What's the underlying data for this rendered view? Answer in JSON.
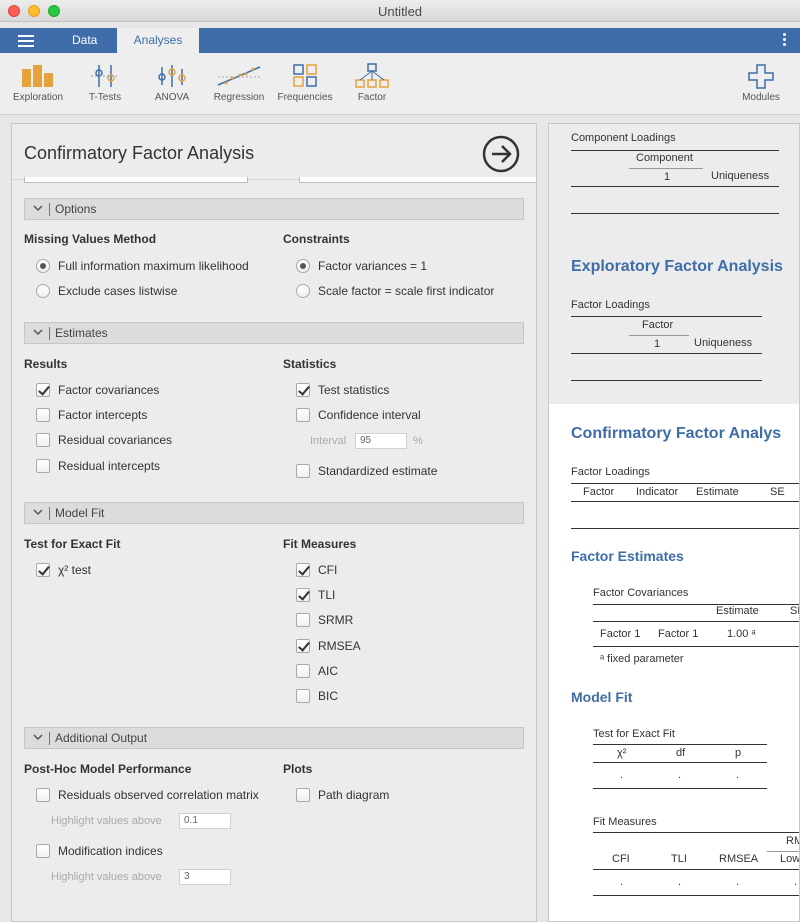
{
  "window": {
    "title": "Untitled"
  },
  "tabs": {
    "data": "Data",
    "analyses": "Analyses"
  },
  "ribbon": [
    {
      "label": "Exploration",
      "icon": "exploration-icon"
    },
    {
      "label": "T-Tests",
      "icon": "ttests-icon"
    },
    {
      "label": "ANOVA",
      "icon": "anova-icon"
    },
    {
      "label": "Regression",
      "icon": "regression-icon"
    },
    {
      "label": "Frequencies",
      "icon": "frequencies-icon"
    },
    {
      "label": "Factor",
      "icon": "factor-icon"
    },
    {
      "label": "Modules",
      "icon": "modules-icon"
    }
  ],
  "panel": {
    "title": "Confirmatory Factor Analysis"
  },
  "options": {
    "section": "Options",
    "missing": {
      "title": "Missing Values Method",
      "fiml": "Full information maximum likelihood",
      "listwise": "Exclude cases listwise"
    },
    "constraints": {
      "title": "Constraints",
      "var1": "Factor variances = 1",
      "scale": "Scale factor = scale first indicator"
    }
  },
  "estimates": {
    "section": "Estimates",
    "results": {
      "title": "Results",
      "fcov": "Factor covariances",
      "fint": "Factor intercepts",
      "rcov": "Residual covariances",
      "rint": "Residual intercepts"
    },
    "statistics": {
      "title": "Statistics",
      "test": "Test statistics",
      "ci": "Confidence interval",
      "interval_label": "Interval",
      "interval_value": "95",
      "interval_unit": "%",
      "std": "Standardized estimate"
    }
  },
  "modelfit": {
    "section": "Model Fit",
    "exact": {
      "title": "Test for Exact Fit",
      "chi": "χ² test"
    },
    "measures": {
      "title": "Fit Measures",
      "cfi": "CFI",
      "tli": "TLI",
      "srmr": "SRMR",
      "rmsea": "RMSEA",
      "aic": "AIC",
      "bic": "BIC"
    }
  },
  "additional": {
    "section": "Additional Output",
    "posthoc": {
      "title": "Post-Hoc Model Performance",
      "resid": "Residuals observed correlation matrix",
      "highlight1_label": "Highlight values above",
      "highlight1_value": "0.1",
      "modind": "Modification indices",
      "highlight2_label": "Highlight values above",
      "highlight2_value": "3"
    },
    "plots": {
      "title": "Plots",
      "path": "Path diagram"
    }
  },
  "results": {
    "comp_loadings": "Component Loadings",
    "component": "Component",
    "comp_one": "1",
    "uniqueness1": "Uniqueness",
    "efa_title": "Exploratory Factor Analysis",
    "factor_loadings1": "Factor Loadings",
    "factor": "Factor",
    "factor_one": "1",
    "uniqueness2": "Uniqueness",
    "cfa_title": "Confirmatory Factor Analys",
    "factor_loadings2": "Factor Loadings",
    "fl_cols": [
      "Factor",
      "Indicator",
      "Estimate",
      "SE"
    ],
    "factor_estimates": "Factor Estimates",
    "factor_cov": "Factor Covariances",
    "fc_estimate": "Estimate",
    "fc_se": "SE",
    "fc_row": [
      "Factor 1",
      "Factor 1",
      "1.00 ᵃ"
    ],
    "fc_note": "ᵃ fixed parameter",
    "model_fit": "Model Fit",
    "exact_fit": "Test for Exact Fit",
    "ef_cols": [
      "χ²",
      "df",
      "p"
    ],
    "ef_vals": [
      ".",
      ".",
      "."
    ],
    "fit_measures": "Fit Measures",
    "fm_group": "RM",
    "fm_cols": [
      "CFI",
      "TLI",
      "RMSEA",
      "Low"
    ],
    "fm_vals": [
      ".",
      ".",
      ".",
      "."
    ]
  }
}
